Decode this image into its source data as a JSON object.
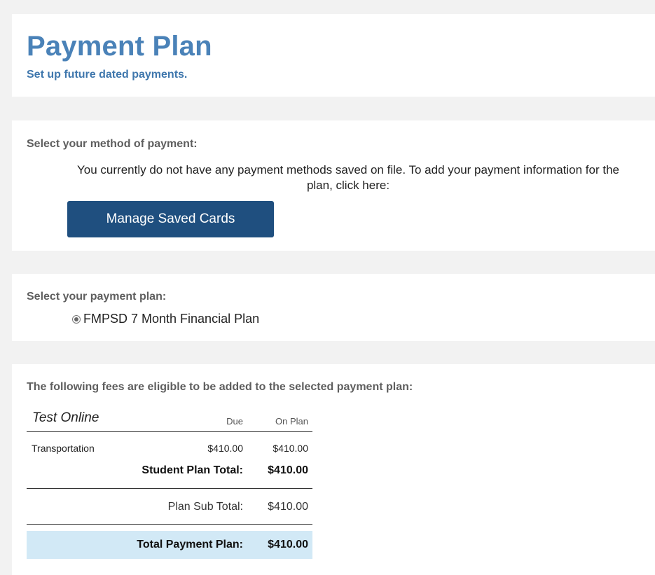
{
  "header": {
    "title": "Payment Plan",
    "subtitle": "Set up future dated payments."
  },
  "payment_method": {
    "label": "Select your method of payment:",
    "message": "You currently do not have any payment methods saved on file. To add your payment information for the plan, click here:",
    "button_label": "Manage Saved Cards"
  },
  "payment_plan": {
    "label": "Select your payment plan:",
    "option_label": "FMPSD 7 Month Financial Plan",
    "selected": true
  },
  "fees": {
    "label": "The following fees are eligible to be added to the selected payment plan:",
    "student_name": "Test Online",
    "col_due": "Due",
    "col_on_plan": "On Plan",
    "items": [
      {
        "name": "Transportation",
        "due": "$410.00",
        "on_plan": "$410.00"
      }
    ],
    "student_total_label": "Student Plan Total:",
    "student_total_value": "$410.00",
    "sub_total_label": "Plan Sub Total:",
    "sub_total_value": "$410.00",
    "grand_total_label": "Total Payment Plan:",
    "grand_total_value": "$410.00"
  },
  "colors": {
    "title": "#4a82b8",
    "button": "#1f4f7f",
    "total_band": "#d2e9f6"
  }
}
